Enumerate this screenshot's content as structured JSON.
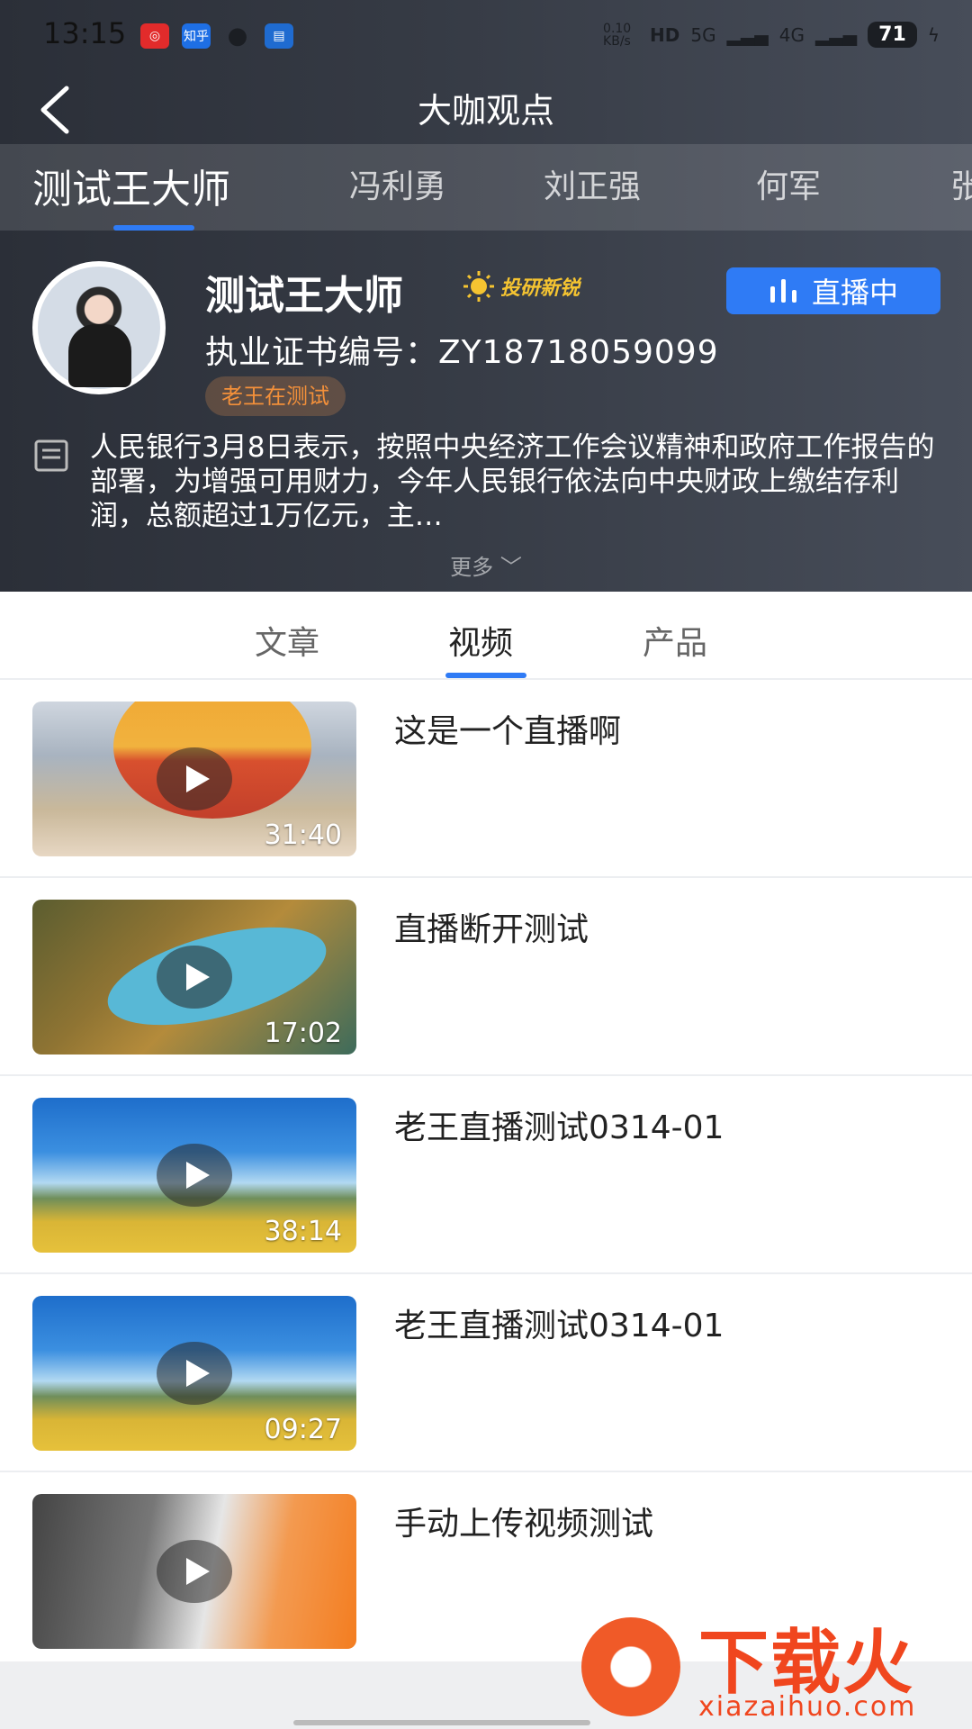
{
  "status": {
    "time": "13:15",
    "apps": [
      "weibo",
      "知乎",
      "message",
      "app"
    ],
    "speed": "0.10 KB/s",
    "hd": "HD",
    "net1": "5G",
    "net2": "4G",
    "battery": "71"
  },
  "nav": {
    "title": "大咖观点"
  },
  "expert_tabs": [
    {
      "label": "测试王大师"
    },
    {
      "label": "冯利勇"
    },
    {
      "label": "刘正强"
    },
    {
      "label": "何军"
    },
    {
      "label": "张"
    }
  ],
  "expert": {
    "name": "测试王大师",
    "badge": "投研新锐",
    "live_label": "直播中",
    "license": "执业证书编号：ZY18718059099",
    "tag": "老王在测试",
    "description": "人民银行3月8日表示，按照中央经济工作会议精神和政府工作报告的部署，为增强可用财力，今年人民银行依法向中央财政上缴结存利润，总额超过1万亿元，主…",
    "more": "更多"
  },
  "content_tabs": [
    {
      "label": "文章"
    },
    {
      "label": "视频"
    },
    {
      "label": "产品"
    }
  ],
  "videos": [
    {
      "title": "这是一个直播啊",
      "duration": "31:40"
    },
    {
      "title": "直播断开测试",
      "duration": "17:02"
    },
    {
      "title": "老王直播测试0314-01",
      "duration": "38:14"
    },
    {
      "title": "老王直播测试0314-01",
      "duration": "09:27"
    },
    {
      "title": "手动上传视频测试",
      "duration": ""
    }
  ],
  "watermark": {
    "text": "下载火",
    "url": "xiazaihuo.com"
  },
  "colors": {
    "accent": "#2f7bf5",
    "tag": "#f3903a",
    "badge": "#f5c431"
  }
}
